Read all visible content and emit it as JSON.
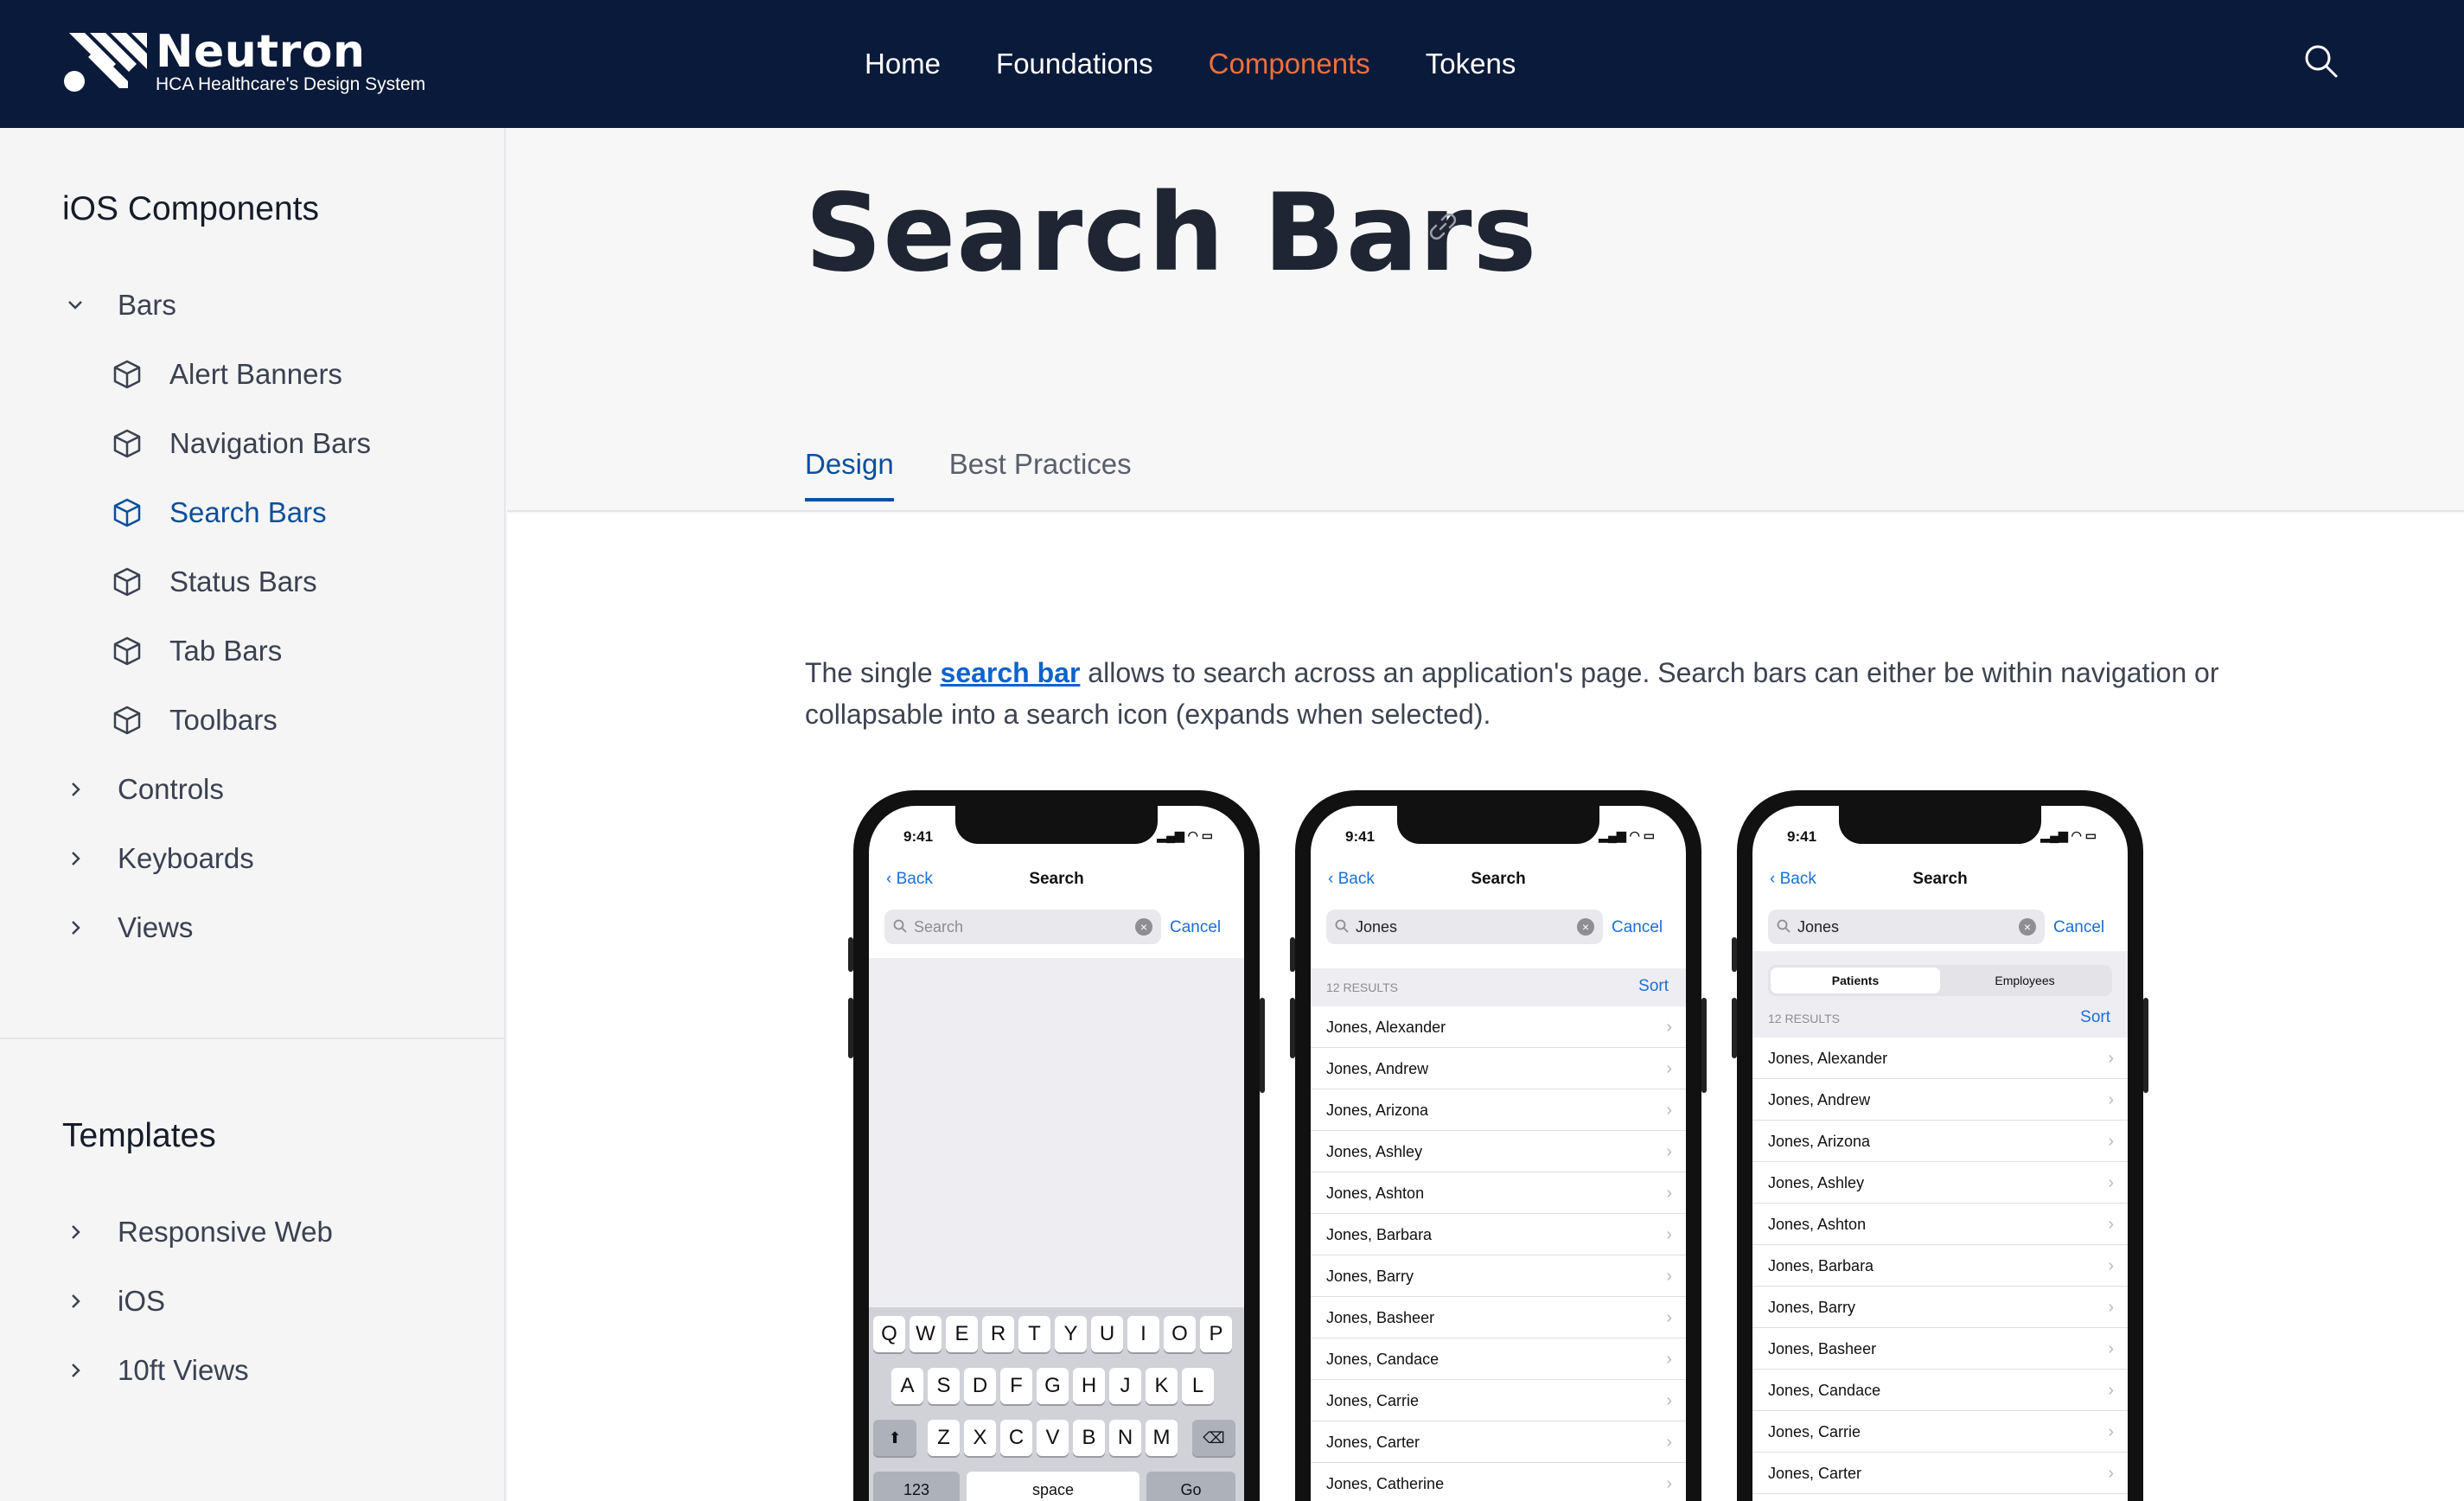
{
  "header": {
    "brand_title": "Neutron",
    "brand_subtitle": "HCA Healthcare's Design System",
    "nav": [
      "Home",
      "Foundations",
      "Components",
      "Tokens"
    ],
    "active_nav": "Components",
    "accent_color": "#f26f3a",
    "background_color": "#0a1a3a"
  },
  "sidebar": {
    "section1_title": "iOS Components",
    "groups": [
      {
        "label": "Bars",
        "expanded": true
      },
      {
        "label": "Controls",
        "expanded": false
      },
      {
        "label": "Keyboards",
        "expanded": false
      },
      {
        "label": "Views",
        "expanded": false
      }
    ],
    "bars_children": [
      "Alert Banners",
      "Navigation Bars",
      "Search Bars",
      "Status Bars",
      "Tab Bars",
      "Toolbars"
    ],
    "active_item": "Search Bars",
    "section2_title": "Templates",
    "template_groups": [
      "Responsive Web",
      "iOS",
      "10ft Views"
    ],
    "active_color": "#0b4f9c"
  },
  "main": {
    "title": "Search Bars",
    "tabs": [
      "Design",
      "Best Practices"
    ],
    "active_tab": "Design",
    "intro_before_link": "The single ",
    "intro_link": "search bar",
    "intro_after_link": " allows to search across an application's page. Search bars can either be within navigation or collapsable into a search icon (expands when selected)."
  },
  "phones": {
    "time": "9:41",
    "back_label": "Back",
    "nav_title": "Search",
    "cancel_label": "Cancel",
    "placeholder": "Search",
    "query": "Jones",
    "results_count": "12 RESULTS",
    "sort_label": "Sort",
    "segments": [
      "Patients",
      "Employees"
    ],
    "phone2_results": [
      "Jones, Alexander",
      "Jones, Andrew",
      "Jones, Arizona",
      "Jones, Ashley",
      "Jones, Ashton",
      "Jones, Barbara",
      "Jones, Barry",
      "Jones, Basheer",
      "Jones, Candace",
      "Jones, Carrie",
      "Jones, Carter",
      "Jones, Catherine"
    ],
    "phone3_results": [
      "Jones, Alexander",
      "Jones, Andrew",
      "Jones, Arizona",
      "Jones, Ashley",
      "Jones, Ashton",
      "Jones, Barbara",
      "Jones, Barry",
      "Jones, Basheer",
      "Jones, Candace",
      "Jones, Carrie",
      "Jones, Carter"
    ],
    "keyboard_rows": [
      [
        "Q",
        "W",
        "E",
        "R",
        "T",
        "Y",
        "U",
        "I",
        "O",
        "P"
      ],
      [
        "A",
        "S",
        "D",
        "F",
        "G",
        "H",
        "J",
        "K",
        "L"
      ],
      [
        "Z",
        "X",
        "C",
        "V",
        "B",
        "N",
        "M"
      ]
    ],
    "key_123": "123",
    "key_space": "space",
    "key_go": "Go"
  }
}
